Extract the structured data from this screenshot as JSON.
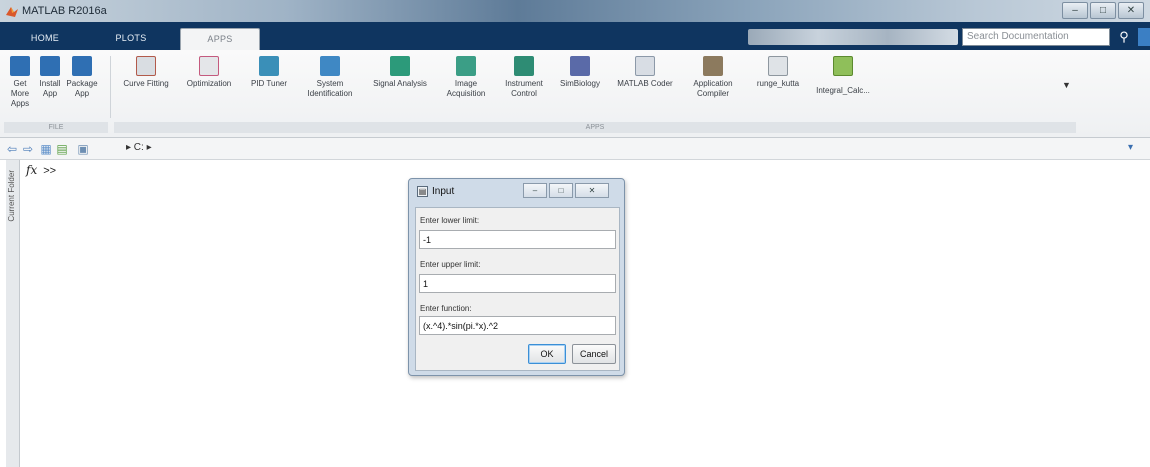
{
  "window": {
    "title": "MATLAB R2016a",
    "controls": [
      "–",
      "□",
      "✕"
    ]
  },
  "tabs": [
    "HOME",
    "PLOTS",
    "APPS"
  ],
  "search": {
    "placeholder": "Search Documentation"
  },
  "ribbon": {
    "buttons": [
      {
        "label": "Get More Apps",
        "icon": "get-more-apps-icon",
        "color": "#2f6fb3"
      },
      {
        "label": "Install App",
        "icon": "install-app-icon",
        "color": "#2f6fb3"
      },
      {
        "label": "Package App",
        "icon": "package-app-icon",
        "color": "#2f6fb3"
      },
      {
        "label": "Curve Fitting",
        "icon": "curve-fitting-icon",
        "color": "#d9dde2"
      },
      {
        "label": "Optimization",
        "icon": "optimization-icon",
        "color": "#e4e6e9"
      },
      {
        "label": "PID Tuner",
        "icon": "pid-tuner-icon",
        "color": "#3a8fb8"
      },
      {
        "label": "System Identification",
        "icon": "system-identification-icon",
        "color": "#3f88c4"
      },
      {
        "label": "Signal Analysis",
        "icon": "signal-analysis-icon",
        "color": "#2c9a7a"
      },
      {
        "label": "Image Acquisition",
        "icon": "image-acquisition-icon",
        "color": "#3b9e86"
      },
      {
        "label": "Instrument Control",
        "icon": "instrument-control-icon",
        "color": "#2e8c74"
      },
      {
        "label": "SimBiology",
        "icon": "simbiology-icon",
        "color": "#5a6aa8"
      },
      {
        "label": "MATLAB Coder",
        "icon": "matlab-coder-icon",
        "color": "#d8dde4"
      },
      {
        "label": "Application Compiler",
        "icon": "application-compiler-icon",
        "color": "#8c7a5e"
      },
      {
        "label": "runge_kutta",
        "icon": "runge-kutta-app-icon",
        "color": "#dfe3e7"
      },
      {
        "label": "Integral_Calc...",
        "icon": "integral-calc-app-icon",
        "color": "#8fbf5a"
      }
    ],
    "sections": [
      "FILE",
      "APPS"
    ]
  },
  "path": {
    "text": "▸ C: ▸"
  },
  "side_panel": {
    "label": "Current Folder"
  },
  "command": {
    "prompt": ">>",
    "fx": "fx"
  },
  "dialog": {
    "title": "Input",
    "fields": [
      {
        "label": "Enter lower limit:",
        "value": "-1"
      },
      {
        "label": "Enter upper limit:",
        "value": "1"
      },
      {
        "label": "Enter function:",
        "value": "(x.^4).*sin(pi.*x).^2"
      }
    ],
    "ok": "OK",
    "cancel": "Cancel"
  }
}
